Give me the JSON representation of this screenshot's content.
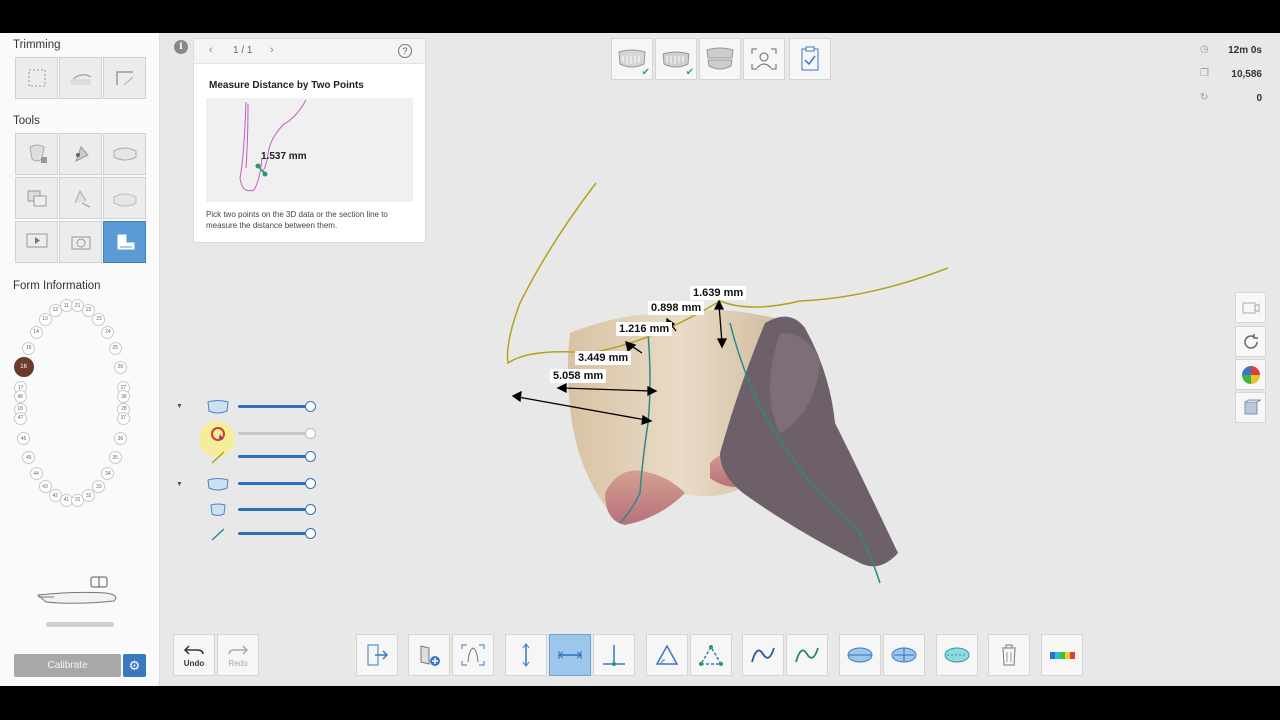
{
  "left_panel": {
    "trimming_title": "Trimming",
    "tools_title": "Tools",
    "form_info_title": "Form Information",
    "calibrate_label": "Calibrate",
    "teeth_upper": [
      "18",
      "17",
      "16",
      "15",
      "14",
      "13",
      "12",
      "11",
      "21",
      "22",
      "23",
      "24",
      "25",
      "26",
      "27",
      "28"
    ],
    "teeth_lower": [
      "48",
      "47",
      "46",
      "45",
      "44",
      "43",
      "42",
      "41",
      "31",
      "32",
      "33",
      "34",
      "35",
      "36",
      "37",
      "38"
    ],
    "selected_tooth": "16"
  },
  "guide": {
    "pages": "1 / 1",
    "help_label": "?",
    "info_label": "i",
    "title": "Measure Distance by Two Points",
    "example_measurement": "1.537 mm",
    "description": "Pick two points on the 3D data or the section line to measure the distance between them."
  },
  "stats": {
    "time": "12m 0s",
    "count": "10,586",
    "other": "0"
  },
  "measurements": {
    "m1": "1.639 mm",
    "m2": "0.898 mm",
    "m3": "1.216 mm",
    "m4": "3.449 mm",
    "m5": "5.058 mm"
  },
  "bottom_toolbar": {
    "undo_label": "Undo",
    "redo_label": "Redo"
  },
  "colors": {
    "accent_blue": "#2f6fc0",
    "active_tool": "#5b9bd5",
    "section_line": "#b2a21c",
    "check_green": "#3aa757",
    "selected_tooth": "#6b3a2a"
  },
  "icons": {
    "stat_time": "clock-icon",
    "stat_count": "copy-icon",
    "stat_other": "rotate-icon"
  }
}
